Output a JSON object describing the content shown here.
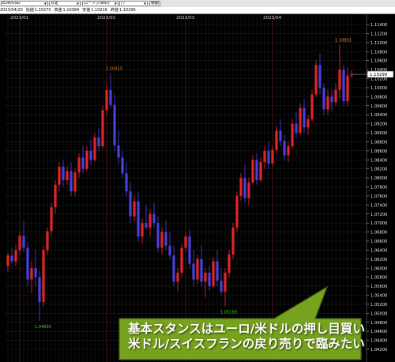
{
  "toolbar": {
    "symbol": "EUR/USD",
    "timeframe": "日足",
    "chart_style": "ローソク(BID)",
    "date_input": "/ /",
    "go_button": "移動"
  },
  "info_bar": {
    "date": "2023/04/20",
    "open_label": "始値",
    "open_value": "1.10270",
    "high_label": "高値",
    "high_value": "1.10384",
    "low_label": "安値",
    "low_value": "1.10216",
    "close_label": "終値",
    "close_value": "1.10296"
  },
  "callout": {
    "line1": "基本スタンスはユーロ/米ドルの押し目買い",
    "line2": "米ドル/スイスフランの戻り売りで臨みたい"
  },
  "colors": {
    "background": "#000000",
    "grid": "#1c1c1c",
    "up_candle": "#e0262a",
    "down_candle": "#4a40dc",
    "low_annotation": "#22dd22",
    "high_annotation": "#ff8c1a",
    "price_tag_bg": "#ffffff",
    "callout_fill": "#77a21e"
  },
  "chart_data": {
    "type": "candlestick",
    "symbol": "EUR/USD",
    "timeframe": "daily",
    "y_ticks": [
      "1.11400",
      "1.11200",
      "1.11000",
      "1.10800",
      "1.10600",
      "1.10400",
      "1.10200",
      "1.10000",
      "1.09800",
      "1.09600",
      "1.09400",
      "1.09200",
      "1.09000",
      "1.08800",
      "1.08600",
      "1.08400",
      "1.08200",
      "1.08000",
      "1.07800",
      "1.07600",
      "1.07400",
      "1.07200",
      "1.07000",
      "1.06800",
      "1.06600",
      "1.06400",
      "1.06200",
      "1.06000",
      "1.05800",
      "1.05600",
      "1.05400",
      "1.05200",
      "1.05000",
      "1.04800",
      "1.04600",
      "1.04400",
      "1.04200"
    ],
    "ylim": [
      1.041,
      1.1155
    ],
    "x_labels": [
      {
        "label": "2023/01",
        "index": 3
      },
      {
        "label": "2023/02",
        "index": 25
      },
      {
        "label": "2023/03",
        "index": 45
      },
      {
        "label": "2023/04",
        "index": 67
      }
    ],
    "current_price": "1.10296",
    "annotations": [
      {
        "text": "1.04830",
        "type": "low",
        "index": 8,
        "price": 1.0483
      },
      {
        "text": "1.10323",
        "type": "high",
        "index": 26,
        "price": 1.10323
      },
      {
        "text": "1.05159",
        "type": "low",
        "index": 55,
        "price": 1.05159
      },
      {
        "text": "1.10953",
        "type": "high",
        "index": 84,
        "price": 1.10953
      }
    ],
    "candles": [
      [
        1.0605,
        1.0635,
        1.0592,
        1.0628
      ],
      [
        1.0628,
        1.0645,
        1.061,
        1.0615
      ],
      [
        1.0615,
        1.0652,
        1.0605,
        1.064
      ],
      [
        1.064,
        1.068,
        1.063,
        1.0672
      ],
      [
        1.0672,
        1.0705,
        1.0635,
        1.0645
      ],
      [
        1.0645,
        1.0658,
        1.056,
        1.0575
      ],
      [
        1.0575,
        1.0615,
        1.0545,
        1.06
      ],
      [
        1.06,
        1.064,
        1.056,
        1.058
      ],
      [
        1.058,
        1.0595,
        1.0483,
        1.0525
      ],
      [
        1.0525,
        1.065,
        1.0515,
        1.064
      ],
      [
        1.064,
        1.069,
        1.063,
        1.0682
      ],
      [
        1.0682,
        1.0745,
        1.067,
        1.0735
      ],
      [
        1.0735,
        1.0795,
        1.072,
        1.0785
      ],
      [
        1.0785,
        1.0835,
        1.077,
        1.0825
      ],
      [
        1.0825,
        1.084,
        1.078,
        1.0795
      ],
      [
        1.0795,
        1.0825,
        1.0785,
        1.0815
      ],
      [
        1.0815,
        1.0835,
        1.076,
        1.077
      ],
      [
        1.077,
        1.082,
        1.076,
        1.0812
      ],
      [
        1.0812,
        1.0855,
        1.08,
        1.0845
      ],
      [
        1.0845,
        1.087,
        1.081,
        1.082
      ],
      [
        1.082,
        1.087,
        1.0815,
        1.086
      ],
      [
        1.086,
        1.0885,
        1.083,
        1.084
      ],
      [
        1.084,
        1.09,
        1.0835,
        1.089
      ],
      [
        1.089,
        1.091,
        1.086,
        1.087
      ],
      [
        1.087,
        1.096,
        1.0865,
        1.095
      ],
      [
        1.095,
        1.1005,
        1.094,
        1.0995
      ],
      [
        1.0995,
        1.10323,
        1.0955,
        1.0962
      ],
      [
        1.0962,
        1.0985,
        1.086,
        1.0872
      ],
      [
        1.0872,
        1.0905,
        1.083,
        1.0845
      ],
      [
        1.0845,
        1.086,
        1.08,
        1.081
      ],
      [
        1.081,
        1.0835,
        1.076,
        1.077
      ],
      [
        1.077,
        1.079,
        1.07,
        1.0715
      ],
      [
        1.0715,
        1.076,
        1.0705,
        1.0748
      ],
      [
        1.0748,
        1.077,
        1.066,
        1.067
      ],
      [
        1.067,
        1.071,
        1.0655,
        1.07
      ],
      [
        1.07,
        1.074,
        1.0685,
        1.069
      ],
      [
        1.069,
        1.073,
        1.067,
        1.072
      ],
      [
        1.072,
        1.0745,
        1.069,
        1.07
      ],
      [
        1.07,
        1.0715,
        1.0635,
        1.0645
      ],
      [
        1.0645,
        1.069,
        1.063,
        1.068
      ],
      [
        1.068,
        1.0705,
        1.064,
        1.065
      ],
      [
        1.065,
        1.068,
        1.062,
        1.0628
      ],
      [
        1.0628,
        1.065,
        1.056,
        1.057
      ],
      [
        1.057,
        1.06,
        1.055,
        1.059
      ],
      [
        1.059,
        1.0655,
        1.058,
        1.0645
      ],
      [
        1.0645,
        1.068,
        1.0635,
        1.067
      ],
      [
        1.067,
        1.0685,
        1.06,
        1.061
      ],
      [
        1.061,
        1.064,
        1.056,
        1.0575
      ],
      [
        1.0575,
        1.063,
        1.0565,
        1.062
      ],
      [
        1.062,
        1.065,
        1.056,
        1.057
      ],
      [
        1.057,
        1.06,
        1.0535,
        1.059
      ],
      [
        1.059,
        1.0605,
        1.055,
        1.056
      ],
      [
        1.056,
        1.0625,
        1.0555,
        1.0615
      ],
      [
        1.0615,
        1.064,
        1.056,
        1.0572
      ],
      [
        1.0572,
        1.06,
        1.054,
        1.0548
      ],
      [
        1.0548,
        1.06,
        1.05159,
        1.059
      ],
      [
        1.059,
        1.064,
        1.058,
        1.063
      ],
      [
        1.063,
        1.07,
        1.062,
        1.069
      ],
      [
        1.069,
        1.077,
        1.068,
        1.076
      ],
      [
        1.076,
        1.081,
        1.075,
        1.08
      ],
      [
        1.08,
        1.083,
        1.0745,
        1.0755
      ],
      [
        1.0755,
        1.08,
        1.074,
        1.079
      ],
      [
        1.079,
        1.085,
        1.0785,
        1.084
      ],
      [
        1.084,
        1.0855,
        1.0785,
        1.0795
      ],
      [
        1.0795,
        1.0845,
        1.079,
        1.0835
      ],
      [
        1.0835,
        1.087,
        1.082,
        1.086
      ],
      [
        1.086,
        1.088,
        1.082,
        1.0832
      ],
      [
        1.0832,
        1.087,
        1.0825,
        1.0862
      ],
      [
        1.0862,
        1.0915,
        1.0855,
        1.0905
      ],
      [
        1.0905,
        1.093,
        1.087,
        1.0882
      ],
      [
        1.0882,
        1.0895,
        1.084,
        1.085
      ],
      [
        1.085,
        1.088,
        1.0835,
        1.087
      ],
      [
        1.087,
        1.093,
        1.0865,
        1.092
      ],
      [
        1.092,
        1.0945,
        1.089,
        1.09
      ],
      [
        1.09,
        1.0965,
        1.0895,
        1.0955
      ],
      [
        1.0955,
        1.0975,
        1.09,
        1.0912
      ],
      [
        1.0912,
        1.094,
        1.0895,
        1.093
      ],
      [
        1.093,
        1.0995,
        1.0925,
        1.0985
      ],
      [
        1.0985,
        1.106,
        1.098,
        1.105
      ],
      [
        1.105,
        1.1075,
        1.0985,
        1.1
      ],
      [
        1.1,
        1.101,
        1.094,
        1.0952
      ],
      [
        1.0952,
        1.0995,
        1.094,
        1.098
      ],
      [
        1.098,
        1.0995,
        1.095,
        1.0968
      ],
      [
        1.0968,
        1.101,
        1.096,
        1.0995
      ],
      [
        1.0995,
        1.10953,
        1.0975,
        1.104
      ],
      [
        1.104,
        1.105,
        1.096,
        1.097
      ],
      [
        1.097,
        1.1045,
        1.096,
        1.1027
      ],
      [
        1.1027,
        1.10384,
        1.10216,
        1.10296
      ]
    ]
  }
}
